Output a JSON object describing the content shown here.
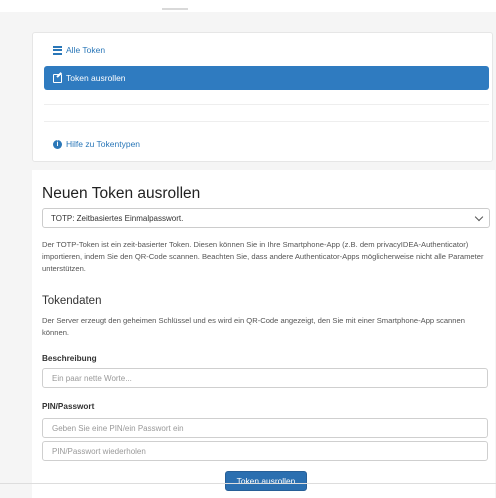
{
  "sidebar": {
    "items": [
      {
        "label": "Alle Token",
        "icon": "list-icon"
      },
      {
        "label": "Token ausrollen",
        "icon": "edit-icon",
        "active": true
      },
      {
        "label": "Hilfe zu Tokentypen",
        "icon": "info-icon"
      }
    ]
  },
  "main": {
    "title": "Neuen Token ausrollen",
    "token_type": {
      "selected": "TOTP: Zeitbasiertes Einmalpasswort."
    },
    "description": "Der TOTP-Token ist ein zeit-basierter Token. Diesen können Sie in Ihre Smartphone-App (z.B. dem privacyIDEA-Authenticator) importieren, indem Sie den QR-Code scannen. Beachten Sie, dass andere Authenticator-Apps möglicherweise nicht alle Parameter unterstützen.",
    "tokendata": {
      "heading": "Tokendaten",
      "text": "Der Server erzeugt den geheimen Schlüssel und es wird ein QR-Code angezeigt, den Sie mit einer Smartphone-App scannen können."
    },
    "fields": {
      "description_label": "Beschreibung",
      "description_placeholder": "Ein paar nette Worte...",
      "pin_label": "PIN/Passwort",
      "pin_placeholder": "Geben Sie eine PIN/ein Passwort ein",
      "pin_repeat_placeholder": "PIN/Passwort wiederholen"
    },
    "submit_label": "Token ausrollen"
  },
  "colors": {
    "accent": "#2f7bc0",
    "link": "#2a77b8",
    "button": "#2b6fb0"
  }
}
